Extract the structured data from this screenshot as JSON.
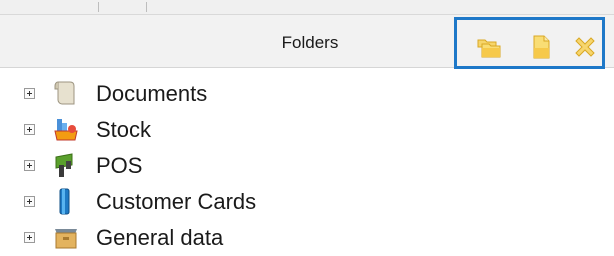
{
  "panel": {
    "title": "Folders"
  },
  "toolbar": {
    "buttons": [
      {
        "icon": "new-folder-icon",
        "color": "#f2c94c"
      },
      {
        "icon": "new-document-icon",
        "color": "#f2c94c"
      },
      {
        "icon": "delete-icon",
        "color": "#f2c94c"
      }
    ],
    "frame_color": "#1e78c8"
  },
  "tree": {
    "items": [
      {
        "label": "Documents",
        "icon": "documents-icon",
        "expanded": false
      },
      {
        "label": "Stock",
        "icon": "stock-icon",
        "expanded": false
      },
      {
        "label": "POS",
        "icon": "pos-icon",
        "expanded": false
      },
      {
        "label": "Customer Cards",
        "icon": "customer-cards-icon",
        "expanded": false
      },
      {
        "label": "General data",
        "icon": "general-data-icon",
        "expanded": false
      }
    ]
  }
}
